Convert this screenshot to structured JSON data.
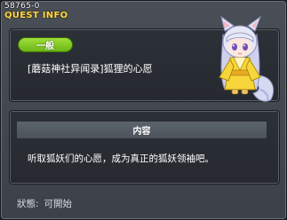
{
  "header": {
    "quest_id": "58765-0",
    "section_title": "QUEST INFO"
  },
  "quest": {
    "category": "一般",
    "title": "[蘑菇神社异闻录]狐狸的心愿",
    "content_header": "内容",
    "description": "听取狐妖们的心愿，成为真正的狐妖领袖吧。"
  },
  "status": {
    "label": "狀態:",
    "value": "可開始"
  },
  "npc": {
    "icon": "fox-girl-npc-icon"
  },
  "colors": {
    "section_title": "#ffd84a",
    "category_badge": "#8bd02a",
    "window_bg": "#43484f",
    "panel_bg": "#292d33"
  }
}
